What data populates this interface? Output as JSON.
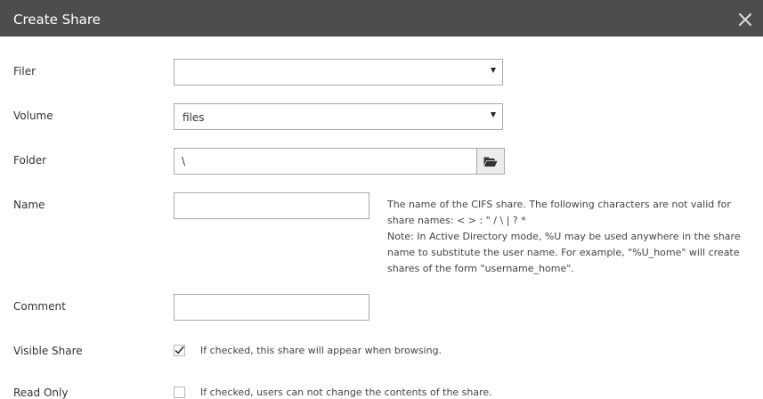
{
  "dialog": {
    "title": "Create Share"
  },
  "fields": {
    "filer": {
      "label": "Filer",
      "value": ""
    },
    "volume": {
      "label": "Volume",
      "value": "files"
    },
    "folder": {
      "label": "Folder",
      "value": "\\"
    },
    "name": {
      "label": "Name",
      "value": "",
      "help_lines": [
        "The name of the CIFS share. The following characters are not valid for",
        "share names: < > : \" / \\ | ? *",
        "Note: In Active Directory mode, %U may be used anywhere in the share",
        "name to substitute the user name. For example, \"%U_home\" will create",
        "shares of the form \"username_home\"."
      ]
    },
    "comment": {
      "label": "Comment",
      "value": ""
    },
    "visible_share": {
      "label": "Visible Share",
      "checked": true,
      "help": "If checked, this share will appear when browsing."
    },
    "read_only": {
      "label": "Read Only",
      "checked": false,
      "help": "If checked, users can not change the contents of the share."
    }
  },
  "icons": {
    "close": "close-icon",
    "browse": "folder-open-icon",
    "dropdown": "caret-down-icon",
    "check": "checkmark-icon"
  },
  "colors": {
    "titlebar": "#4d4d4d",
    "title_text": "#ffffff",
    "border": "#a9a9a9"
  }
}
